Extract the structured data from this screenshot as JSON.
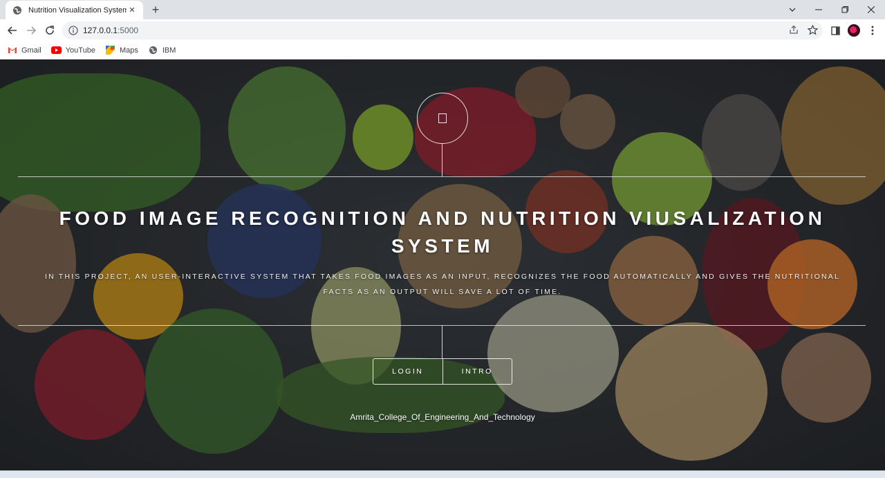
{
  "browser": {
    "tab": {
      "title": "Nutrition Visualization System",
      "favicon": "globe-icon"
    },
    "address": {
      "host": "127.0.0.1",
      "port": ":5000"
    },
    "bookmarks": [
      {
        "label": "Gmail",
        "icon": "gmail-icon"
      },
      {
        "label": "YouTube",
        "icon": "youtube-icon"
      },
      {
        "label": "Maps",
        "icon": "maps-icon"
      },
      {
        "label": "IBM",
        "icon": "globe-icon"
      }
    ]
  },
  "page": {
    "title": "FOOD IMAGE RECOGNITION AND NUTRITION VIUSALIZATION SYSTEM",
    "description": "IN THIS PROJECT, AN USER-INTERACTIVE SYSTEM THAT TAKES FOOD IMAGES AS AN INPUT, RECOGNIZES THE FOOD AUTOMATICALLY AND GIVES THE NUTRITIONAL FACTS AS AN OUTPUT WILL SAVE A LOT OF TIME.",
    "buttons": {
      "login": "LOGIN",
      "intro": "INTRO"
    },
    "footer": "Amrita_College_Of_Engineering_And_Technology",
    "background": "vegetables-and-fruits-photo"
  },
  "colors": {
    "tabstrip": "#dee1e6",
    "omnibox": "#f1f3f4",
    "overlay_text": "#ffffff"
  }
}
